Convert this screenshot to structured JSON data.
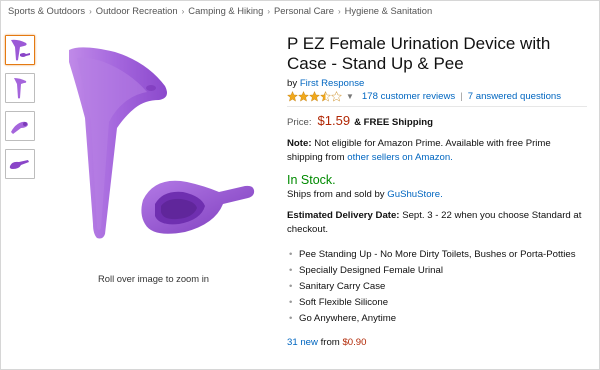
{
  "breadcrumb": {
    "items": [
      "Sports & Outdoors",
      "Outdoor Recreation",
      "Camping & Hiking",
      "Personal Care",
      "Hygiene & Sanitation"
    ],
    "separator": "›"
  },
  "product": {
    "title": "P EZ Female Urination Device with Case - Stand Up & Pee",
    "by_prefix": "by",
    "brand": "First Response",
    "rating_stars": 3.5,
    "reviews_link": "178 customer reviews",
    "questions_link": "7 answered questions",
    "price_label": "Price:",
    "price": "$1.59",
    "shipping_text": "& FREE Shipping",
    "note_label": "Note:",
    "note_text": "Not eligible for Amazon Prime. Available with free Prime shipping from",
    "note_link": "other sellers on Amazon.",
    "stock": "In Stock.",
    "seller_prefix": "Ships from and sold by",
    "seller_name": "GuShuStore.",
    "delivery_label": "Estimated Delivery Date:",
    "delivery_text": "Sept. 3 - 22 when you choose Standard at checkout.",
    "bullets": [
      "Pee Standing Up - No More Dirty Toilets, Bushes or Porta-Potties",
      "Specially Designed Female Urinal",
      "Sanitary Carry Case",
      "Soft Flexible Silicone",
      "Go Anywhere, Anytime"
    ],
    "offers_link": "31 new",
    "offers_from": "from",
    "offers_price": "$0.90"
  },
  "image": {
    "zoom_hint": "Roll over image to zoom in",
    "product_color": "#9b59d6"
  },
  "icons": {
    "star": "star-icon",
    "caret": "caret-down-icon"
  },
  "colors": {
    "link": "#0066c0",
    "price": "#b12704",
    "stock": "#008a00",
    "thumb_active": "#e47911"
  }
}
